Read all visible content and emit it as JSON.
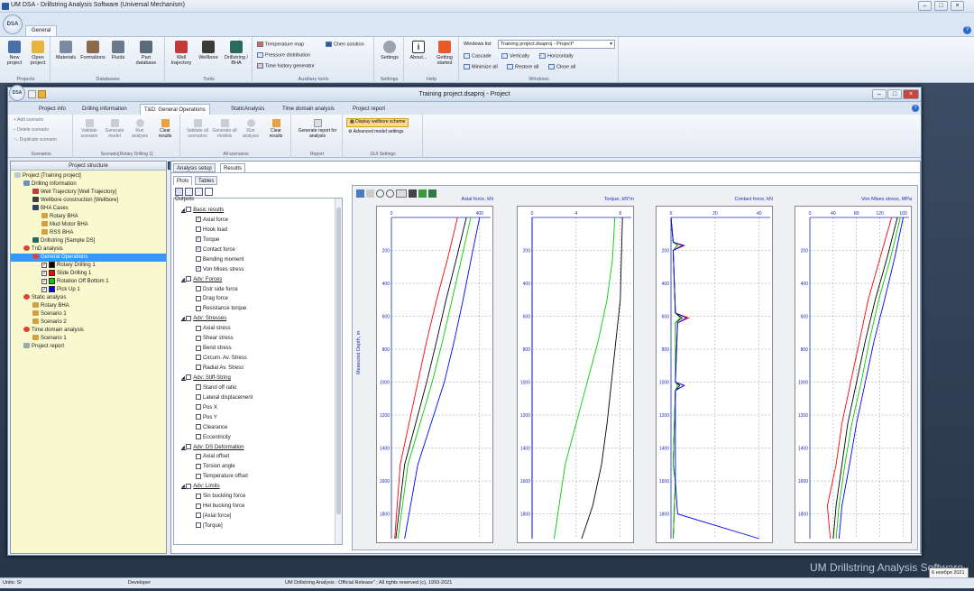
{
  "window": {
    "title": "UM DSA - Drillstring Analysis Software (Universal Mechanism)",
    "ribbon_tab": "General",
    "orb_text": "DSA"
  },
  "ribbon": {
    "projects": {
      "label": "Projects",
      "buttons": [
        "New project",
        "Open project"
      ]
    },
    "databases": {
      "label": "Databases",
      "buttons": [
        "Materials",
        "Formations",
        "Fluids",
        "Part database"
      ]
    },
    "tools": {
      "label": "Tools",
      "buttons": [
        "Well trajectory",
        "Wellbore",
        "Drillstring / BHA"
      ]
    },
    "aux": {
      "label": "Auxiliary tools",
      "items": [
        "Temperature map",
        "Pressure distribution",
        "Time history generator",
        "Chen solution"
      ]
    },
    "settings": {
      "label": "Settings",
      "button": "Settings"
    },
    "help": {
      "label": "Help",
      "buttons": [
        "About...",
        "Getting started"
      ]
    },
    "windows": {
      "label": "Windows",
      "list_label": "Windows list",
      "list_value": "Training project.dsaproj - Project*",
      "items": [
        "Cascade",
        "Vertically",
        "Horizontally",
        "Minimize all",
        "Restore all",
        "Close all"
      ]
    }
  },
  "project": {
    "title": "Training project.dsaproj - Project",
    "tabs": [
      "Project info",
      "Drilling information",
      "T&D: General Operations",
      "StaticAnalysis",
      "Time domain analysis",
      "Project report"
    ],
    "toolbar": {
      "scenarios": {
        "label": "Scenarios",
        "items": [
          "Add scenario",
          "Delete scenario",
          "Duplicate scenario"
        ]
      },
      "scenario_rd": {
        "label": "Scenario[Rotary Drilling 1]",
        "buttons": [
          "Validate scenario",
          "Generate model",
          "Run analysis",
          "Clear results"
        ]
      },
      "all": {
        "label": "All scenarios",
        "buttons": [
          "Validate all scenarios",
          "Generate all models",
          "Run analysis",
          "Clear results"
        ]
      },
      "report": {
        "label": "Report",
        "button": "Generate report for analysis"
      },
      "gui": {
        "label": "GUI Settings",
        "items": [
          "Display wellbore scheme",
          "Advanced model settings"
        ]
      }
    }
  },
  "tree": {
    "header": "Project structure",
    "nodes": [
      {
        "label": "Project [Training project]",
        "lvl": 0,
        "icon": "project-icon"
      },
      {
        "label": "Drilling information",
        "lvl": 1,
        "icon": "drilling-info-icon"
      },
      {
        "label": "Well Trajectory [Well Trajectory]",
        "lvl": 2,
        "icon": "trajectory-icon"
      },
      {
        "label": "Wellbore construction [Wellbore]",
        "lvl": 2,
        "icon": "wellbore-icon"
      },
      {
        "label": "BHA Cases",
        "lvl": 2,
        "icon": "bha-cases-icon"
      },
      {
        "label": "Rotary BHA",
        "lvl": 3,
        "icon": "bha-icon"
      },
      {
        "label": "Mud Motor BHA",
        "lvl": 3,
        "icon": "bha-icon"
      },
      {
        "label": "RSS BHA",
        "lvl": 3,
        "icon": "bha-icon"
      },
      {
        "label": "Drillstring [Sample DS]",
        "lvl": 2,
        "icon": "drillstring-icon"
      },
      {
        "label": "TnD analysis",
        "lvl": 1,
        "icon": "analysis-icon"
      },
      {
        "label": "General Operations",
        "lvl": 2,
        "icon": "analysis-icon",
        "selected": true
      },
      {
        "label": "Rotary Drilling 1",
        "lvl": 3,
        "checked": true,
        "color": "#000000"
      },
      {
        "label": "Slide Drilling 1",
        "lvl": 3,
        "checked": true,
        "color": "#ff0000"
      },
      {
        "label": "Rotation Off Bottom 1",
        "lvl": 3,
        "checked": true,
        "color": "#00cc00"
      },
      {
        "label": "Pick Up 1",
        "lvl": 3,
        "checked": true,
        "color": "#0000ff"
      },
      {
        "label": "Static analysis",
        "lvl": 1,
        "icon": "analysis-icon"
      },
      {
        "label": "Rotary BHA",
        "lvl": 2,
        "icon": "bha-icon"
      },
      {
        "label": "Scenario 1",
        "lvl": 2,
        "icon": "bha-icon"
      },
      {
        "label": "Scenario 2",
        "lvl": 2,
        "icon": "bha-icon"
      },
      {
        "label": "Time domain analysis",
        "lvl": 1,
        "icon": "analysis-icon"
      },
      {
        "label": "Scenario 1",
        "lvl": 2,
        "icon": "bha-icon"
      },
      {
        "label": "Project report",
        "lvl": 1,
        "icon": "report-icon"
      }
    ]
  },
  "results": {
    "tabs": [
      "Analysis setup",
      "Results"
    ],
    "subtabs": [
      "Plots",
      "Tables"
    ],
    "outputs_label": "Outputs",
    "outputs": [
      {
        "label": "Basic results",
        "grp": true
      },
      {
        "label": "Axial force",
        "checked": true
      },
      {
        "label": "Hook load",
        "checked": false
      },
      {
        "label": "Torque",
        "checked": true
      },
      {
        "label": "Contact force",
        "checked": true
      },
      {
        "label": "Bending moment",
        "checked": false
      },
      {
        "label": "Von Mises stress",
        "checked": true
      },
      {
        "label": "Adv: Forces",
        "grp": true
      },
      {
        "label": "Dstr side force",
        "checked": false
      },
      {
        "label": "Drag force",
        "checked": false
      },
      {
        "label": "Resistance torque",
        "checked": false
      },
      {
        "label": "Adv: Stresses",
        "grp": true
      },
      {
        "label": "Axial stress",
        "checked": false
      },
      {
        "label": "Shear stress",
        "checked": false
      },
      {
        "label": "Bend stress",
        "checked": false
      },
      {
        "label": "Circum. Av. Stress",
        "checked": false
      },
      {
        "label": "Radial Av. Stress",
        "checked": false
      },
      {
        "label": "Adv: Stiff-String",
        "grp": true
      },
      {
        "label": "Stand off ratio",
        "checked": false
      },
      {
        "label": "Lateral displacement",
        "checked": false
      },
      {
        "label": "Pos X",
        "checked": false
      },
      {
        "label": "Pos Y",
        "checked": false
      },
      {
        "label": "Clearance",
        "checked": false
      },
      {
        "label": "Eccentricity",
        "checked": false
      },
      {
        "label": "Adv: DS Deformation",
        "grp": true
      },
      {
        "label": "Axial offset",
        "checked": false
      },
      {
        "label": "Torsion angle",
        "checked": false
      },
      {
        "label": "Temperature offset",
        "checked": false
      },
      {
        "label": "Adv: Limits",
        "grp": true
      },
      {
        "label": "Sin buckling force",
        "checked": false
      },
      {
        "label": "Hel bucking force",
        "checked": false
      },
      {
        "label": "[Axial force]",
        "checked": false
      },
      {
        "label": "[Torque]",
        "checked": false
      }
    ]
  },
  "chart_data": [
    {
      "type": "line",
      "title": "Axial force, kN",
      "ylabel": "Measured Depth, m",
      "xlim": [
        0,
        450
      ],
      "ylim": [
        0,
        1950
      ],
      "xticks": [
        0,
        400
      ],
      "yticks": [
        200,
        400,
        600,
        800,
        1000,
        1200,
        1400,
        1600,
        1800
      ],
      "series": [
        {
          "color": "#ff0000",
          "x": [
            300,
            255,
            205,
            160,
            120,
            80,
            40,
            15
          ],
          "y": [
            0,
            250,
            500,
            750,
            1000,
            1250,
            1500,
            1950
          ]
        },
        {
          "color": "#000000",
          "x": [
            340,
            295,
            248,
            205,
            160,
            110,
            60,
            20
          ],
          "y": [
            0,
            250,
            500,
            750,
            1000,
            1250,
            1500,
            1950
          ]
        },
        {
          "color": "#00cc00",
          "x": [
            360,
            318,
            275,
            232,
            185,
            130,
            75,
            30
          ],
          "y": [
            0,
            250,
            500,
            750,
            1000,
            1250,
            1500,
            1950
          ]
        },
        {
          "color": "#0000ff",
          "x": [
            400,
            362,
            325,
            285,
            240,
            180,
            120,
            60
          ],
          "y": [
            0,
            250,
            500,
            750,
            1000,
            1250,
            1500,
            1950
          ]
        }
      ]
    },
    {
      "type": "line",
      "title": "Torque, kN*m",
      "xlim": [
        0,
        9
      ],
      "ylim": [
        0,
        1950
      ],
      "xticks": [
        0,
        4,
        8
      ],
      "yticks": [
        200,
        400,
        600,
        800,
        1000,
        1200,
        1400,
        1600,
        1800
      ],
      "series": [
        {
          "color": "#0000ff",
          "x": [
            0,
            0,
            0
          ],
          "y": [
            0,
            1000,
            1950
          ]
        },
        {
          "color": "#00cc00",
          "x": [
            7.5,
            7.3,
            6.8,
            6.0,
            5.0,
            4.0,
            3.0,
            2.0
          ],
          "y": [
            0,
            250,
            500,
            750,
            1000,
            1250,
            1500,
            1950
          ]
        },
        {
          "color": "#000000",
          "x": [
            8.2,
            8.1,
            8.0,
            7.6,
            7.2,
            6.8,
            6.3,
            5.5,
            4.5
          ],
          "y": [
            0,
            250,
            500,
            750,
            1000,
            1250,
            1500,
            1750,
            1950
          ]
        }
      ]
    },
    {
      "type": "line",
      "title": "Contact force, kN",
      "xlim": [
        0,
        45
      ],
      "ylim": [
        0,
        1950
      ],
      "xticks": [
        0,
        20,
        40
      ],
      "yticks": [
        200,
        400,
        600,
        800,
        1000,
        1200,
        1400,
        1600,
        1800
      ],
      "series": [
        {
          "color": "#ff0000",
          "x": [
            0,
            1,
            5,
            1,
            2,
            8,
            3,
            2,
            6,
            2,
            1,
            2,
            1
          ],
          "y": [
            0,
            150,
            170,
            200,
            580,
            610,
            640,
            1000,
            1020,
            1050,
            1500,
            1600,
            1950
          ]
        },
        {
          "color": "#000000",
          "x": [
            0,
            1,
            3,
            1,
            2,
            5,
            2,
            2,
            4,
            2,
            1,
            2,
            1
          ],
          "y": [
            0,
            150,
            170,
            200,
            580,
            610,
            640,
            1000,
            1020,
            1050,
            1500,
            1600,
            1950
          ]
        },
        {
          "color": "#00cc00",
          "x": [
            0,
            1,
            3,
            1,
            2,
            4,
            2,
            2,
            3,
            2,
            1,
            2,
            1
          ],
          "y": [
            0,
            150,
            170,
            200,
            580,
            610,
            640,
            1000,
            1020,
            1050,
            1500,
            1600,
            1950
          ]
        },
        {
          "color": "#0000ff",
          "x": [
            0,
            1,
            6,
            1,
            2,
            7,
            3,
            2,
            6,
            2,
            2,
            3,
            40
          ],
          "y": [
            0,
            150,
            170,
            200,
            580,
            610,
            640,
            1000,
            1020,
            1050,
            1600,
            1800,
            1950
          ]
        }
      ]
    },
    {
      "type": "line",
      "title": "Von Mises stress, MPa",
      "xlim": [
        0,
        170
      ],
      "ylim": [
        0,
        1950
      ],
      "xticks": [
        0,
        40,
        80,
        120,
        160
      ],
      "yticks": [
        200,
        400,
        600,
        800,
        1000,
        1200,
        1400,
        1600,
        1800
      ],
      "series": [
        {
          "color": "#ff0000",
          "x": [
            140,
            120,
            100,
            85,
            70,
            55,
            45,
            30,
            35
          ],
          "y": [
            0,
            250,
            500,
            750,
            1000,
            1250,
            1500,
            1750,
            1950
          ]
        },
        {
          "color": "#000000",
          "x": [
            150,
            132,
            112,
            95,
            80,
            65,
            55,
            45,
            40
          ],
          "y": [
            0,
            250,
            500,
            750,
            1000,
            1250,
            1500,
            1750,
            1950
          ]
        },
        {
          "color": "#00cc00",
          "x": [
            155,
            138,
            118,
            102,
            88,
            72,
            60,
            50,
            45
          ],
          "y": [
            0,
            250,
            500,
            750,
            1000,
            1250,
            1500,
            1750,
            1950
          ]
        },
        {
          "color": "#0000ff",
          "x": [
            160,
            145,
            128,
            110,
            95,
            80,
            68,
            55,
            50
          ],
          "y": [
            0,
            250,
            500,
            750,
            1000,
            1250,
            1500,
            1750,
            1950
          ]
        }
      ]
    }
  ],
  "status": {
    "units": "Units: SI",
    "mode": "Developer",
    "release": "UM Drillstring Analysis : Official Release\" ; All rights reserved (c), 1993-2021",
    "brand": "UM Drillstring Analysis Software",
    "date": "6 ноября 2021 г.",
    "day": "суббота"
  }
}
